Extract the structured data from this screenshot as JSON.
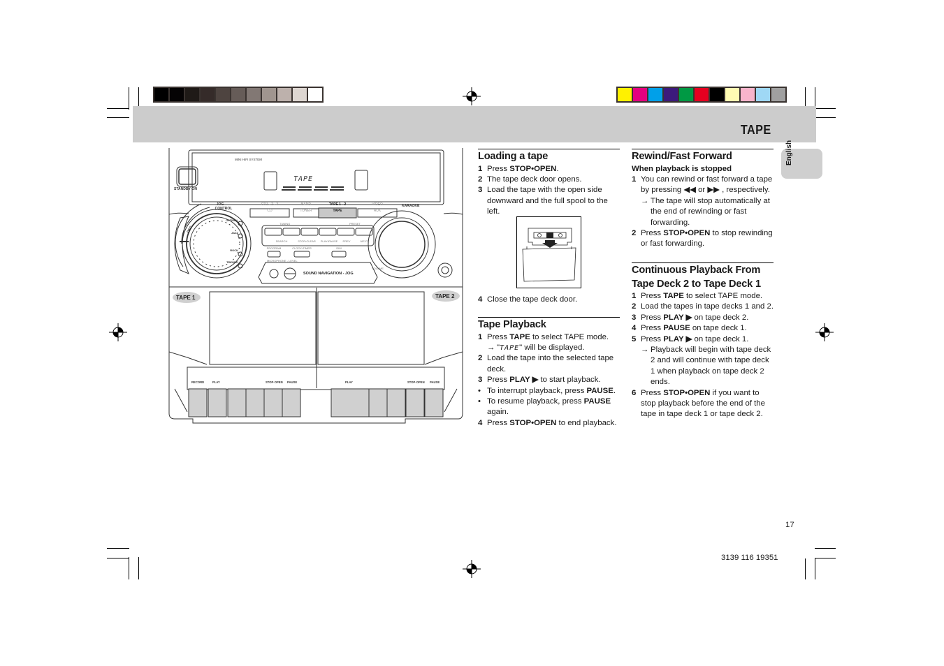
{
  "header": {
    "title": "TAPE"
  },
  "language_tab": "English",
  "registration_marks": {
    "gray_swatches": [
      "#000000",
      "#050304",
      "#1f1a17",
      "#352b29",
      "#4e4440",
      "#665c58",
      "#827874",
      "#a0958f",
      "#bdb1ac",
      "#ddd6d1",
      "#ffffff"
    ],
    "color_swatches": [
      "#fff100",
      "#e4007f",
      "#00a0e9",
      "#3c1a7c",
      "#009944",
      "#e60020",
      "#000000",
      "#fffbb3",
      "#f8b4cb",
      "#9fd8f5",
      "#a0a0a0"
    ]
  },
  "device": {
    "model_label": "MINI HIFI SYSTEM",
    "standby_label": "STANDBY·ON",
    "display_text": "TAPE",
    "jog_control_label": "JOG CONTROL",
    "source_top_labels": [
      "CD1 - 2 - 3",
      "BAND",
      "TAPE 1 - 2",
      "VIDEO"
    ],
    "source_buttons": [
      "CD",
      "TUNER",
      "TAPE",
      "AUX"
    ],
    "karaoke_label": "KARAOKE",
    "dsc_label": "DSC",
    "dsc_presets": [
      "OPTIMAL",
      "JAZZ",
      "ROCK",
      "TECHNO"
    ],
    "tuning_label": "TUNING",
    "preset_label": "PRESET",
    "transport_labels": [
      "SEARCH",
      "STOP•CLEAR",
      "PLAY•PAUSE",
      "PREV",
      "NEXT"
    ],
    "small_buttons": [
      "PROGRAM",
      "CLOCK•TIMER",
      "DIM"
    ],
    "mic_label": "MICROPHONE - LEVEL",
    "sound_nav_label": "SOUND NAVIGATION - JOG",
    "volume_label": "VOLUME",
    "tape1_label": "TAPE 1",
    "tape2_label": "TAPE 2",
    "deck1_keys": [
      "RECORD",
      "PLAY",
      "STOP·OPEN",
      "PAUSE"
    ],
    "deck2_keys": [
      "PLAY",
      "STOP·OPEN",
      "PAUSE"
    ]
  },
  "loading": {
    "title": "Loading a tape",
    "steps": [
      {
        "n": "1",
        "pre": "Press ",
        "bold": "STOP•OPEN",
        "post": "."
      },
      {
        "n": "2",
        "text": "The tape deck door opens."
      },
      {
        "n": "3",
        "text": "Load the tape with the open side downward and the full spool to the left."
      }
    ],
    "step4": {
      "n": "4",
      "text": "Close the tape deck door."
    }
  },
  "playback": {
    "title": "Tape Playback",
    "s1": {
      "n": "1",
      "pre": "Press ",
      "bold": "TAPE",
      "post": " to select TAPE mode."
    },
    "s1_arrow": {
      "arrow": "→",
      "q1": " \"",
      "lcd": "TAPE",
      "q2": "\" will be displayed."
    },
    "s2": {
      "n": "2",
      "text": "Load the tape into the selected tape deck."
    },
    "s3": {
      "n": "3",
      "pre": "Press ",
      "bold": "PLAY ▶",
      "post": "  to start playback."
    },
    "b1": {
      "pre": "To interrupt playback, press ",
      "bold": "PAUSE",
      "post": "."
    },
    "b2": {
      "pre": "To resume playback, press ",
      "bold": "PAUSE",
      "post": " again."
    },
    "s4": {
      "n": "4",
      "pre": "Press ",
      "bold": "STOP•OPEN",
      "post": " to end playback."
    }
  },
  "rewind": {
    "title": "Rewind/Fast Forward",
    "subtitle": "When playback is stopped",
    "s1": {
      "n": "1",
      "text": "You can rewind or fast forward a tape by pressing ◀◀ or ▶▶ , respectively."
    },
    "s1_arrow": {
      "arrow": "→",
      "text": "The tape will stop automatically at the end of rewinding or fast forwarding."
    },
    "s2": {
      "n": "2",
      "pre": "Press ",
      "bold": "STOP•OPEN",
      "post": " to stop rewinding or fast forwarding."
    }
  },
  "continuous": {
    "title": "Continuous Playback From Tape Deck 2 to Tape Deck 1",
    "s1": {
      "n": "1",
      "pre": "Press ",
      "bold": "TAPE",
      "post": " to select TAPE mode."
    },
    "s2": {
      "n": "2",
      "text": "Load the tapes in tape decks 1 and 2."
    },
    "s3": {
      "n": "3",
      "pre": "Press ",
      "bold": "PLAY ▶",
      "post": " on tape deck 2."
    },
    "s4": {
      "n": "4",
      "pre": "Press ",
      "bold": "PAUSE",
      "post": " on tape deck 1."
    },
    "s5": {
      "n": "5",
      "pre": "Press ",
      "bold": "PLAY ▶",
      "post": " on tape deck 1."
    },
    "s5_arrow": {
      "arrow": "→",
      "text": "Playback will begin with tape deck 2 and will continue with tape deck 1 when playback on tape deck 2 ends."
    },
    "s6": {
      "n": "6",
      "pre": "Press ",
      "bold": "STOP•OPEN",
      "post": " if you want to stop playback before the end of the tape in tape deck 1 or tape deck 2."
    }
  },
  "footer": {
    "page_number": "17",
    "doc_number": "3139 116 19351"
  }
}
